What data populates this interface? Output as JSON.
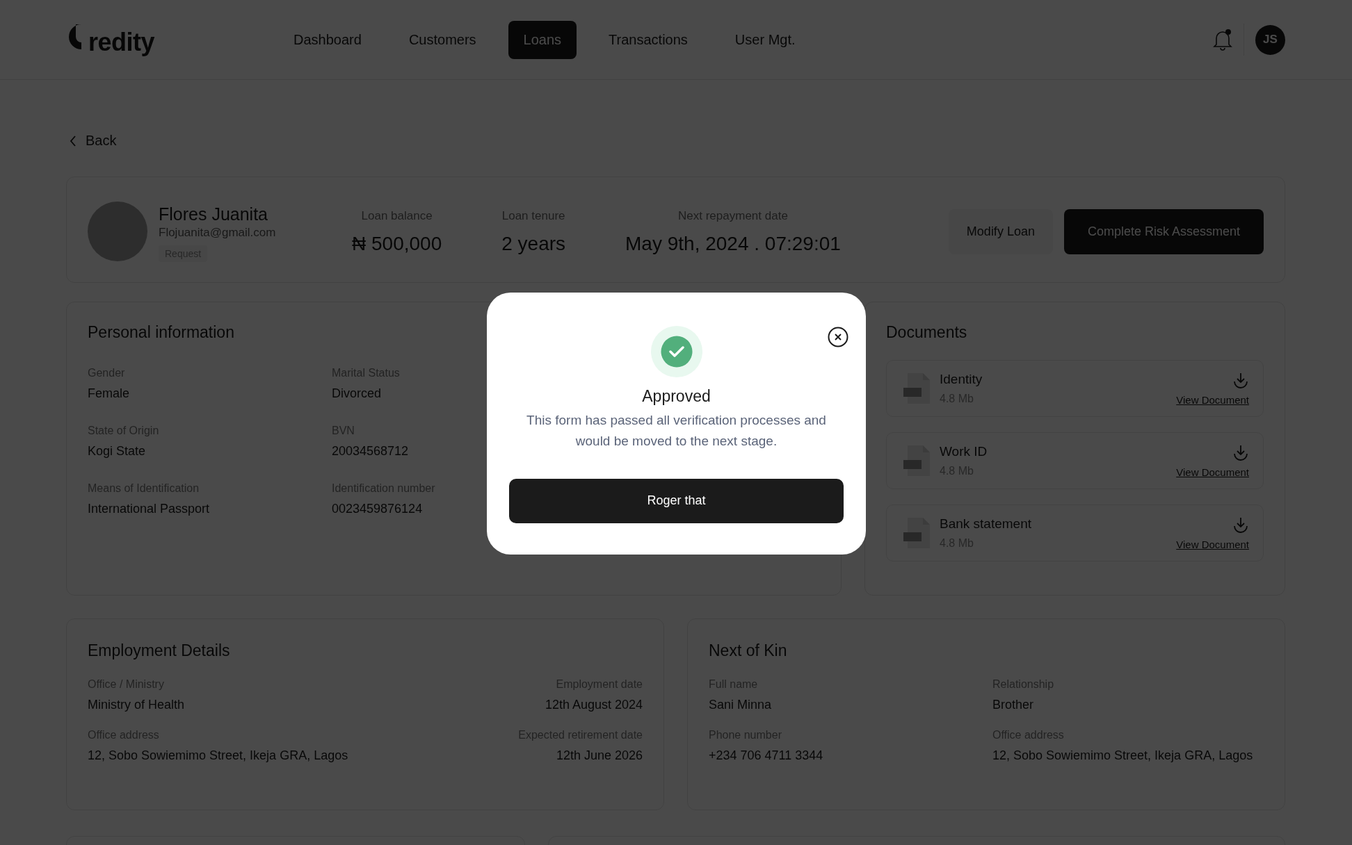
{
  "header": {
    "logo_text": "redity",
    "nav": [
      {
        "label": "Dashboard",
        "selected": false
      },
      {
        "label": "Customers",
        "selected": false
      },
      {
        "label": "Loans",
        "selected": true
      },
      {
        "label": "Transactions",
        "selected": false
      },
      {
        "label": "User Mgt.",
        "selected": false
      }
    ],
    "notification_unread": true,
    "avatar_initials": "JS"
  },
  "back_label": "Back",
  "profile": {
    "name": "Flores Juanita",
    "email": "Flojuanita@gmail.com",
    "tag": "Request",
    "stats": [
      {
        "label": "Loan balance",
        "value": "₦ 500,000"
      },
      {
        "label": "Loan tenure",
        "value": "2 years"
      },
      {
        "label": "Next repayment date",
        "value": "May 9th, 2024 . 07:29:01"
      }
    ],
    "secondary_button": "Modify Loan",
    "primary_button": "Complete Risk Assessment"
  },
  "personal_information": {
    "title": "Personal information",
    "fields": [
      {
        "label": "Gender",
        "value": "Female"
      },
      {
        "label": "Marital Status",
        "value": "Divorced"
      },
      {
        "label": "State of Origin",
        "value": "Kogi State"
      },
      {
        "label": "BVN",
        "value": "20034568712"
      },
      {
        "label": "Means of Identification",
        "value": "International Passport"
      },
      {
        "label": "Identification number",
        "value": "0023459876124"
      }
    ]
  },
  "documents": {
    "title": "Documents",
    "items": [
      {
        "name": "Identity",
        "size": "4.8 Mb",
        "link": "View Document"
      },
      {
        "name": "Work ID",
        "size": "4.8 Mb",
        "link": "View Document"
      },
      {
        "name": "Bank statement",
        "size": "4.8 Mb",
        "link": "View Document"
      }
    ]
  },
  "employment": {
    "title": "Employment Details",
    "fields": [
      {
        "label": "Office / Ministry",
        "value": "Ministry of Health"
      },
      {
        "label": "Employment date",
        "value": "12th August 2024"
      },
      {
        "label": "Office address",
        "value": "12, Sobo Sowiemimo Street, Ikeja GRA, Lagos"
      },
      {
        "label": "Expected retirement date",
        "value": "12th June 2026"
      }
    ]
  },
  "next_of_kin": {
    "title": "Next of Kin",
    "fields": [
      {
        "label": "Full name",
        "value": "Sani Minna"
      },
      {
        "label": "Relationship",
        "value": "Brother"
      },
      {
        "label": "Phone number",
        "value": "+234 706 4711 3344"
      },
      {
        "label": "Office address",
        "value": "12, Sobo Sowiemimo Street, Ikeja GRA, Lagos"
      }
    ]
  },
  "modal": {
    "title": "Approved",
    "message": "This form has passed all verification processes and would be moved to the next stage.",
    "button": "Roger that"
  }
}
